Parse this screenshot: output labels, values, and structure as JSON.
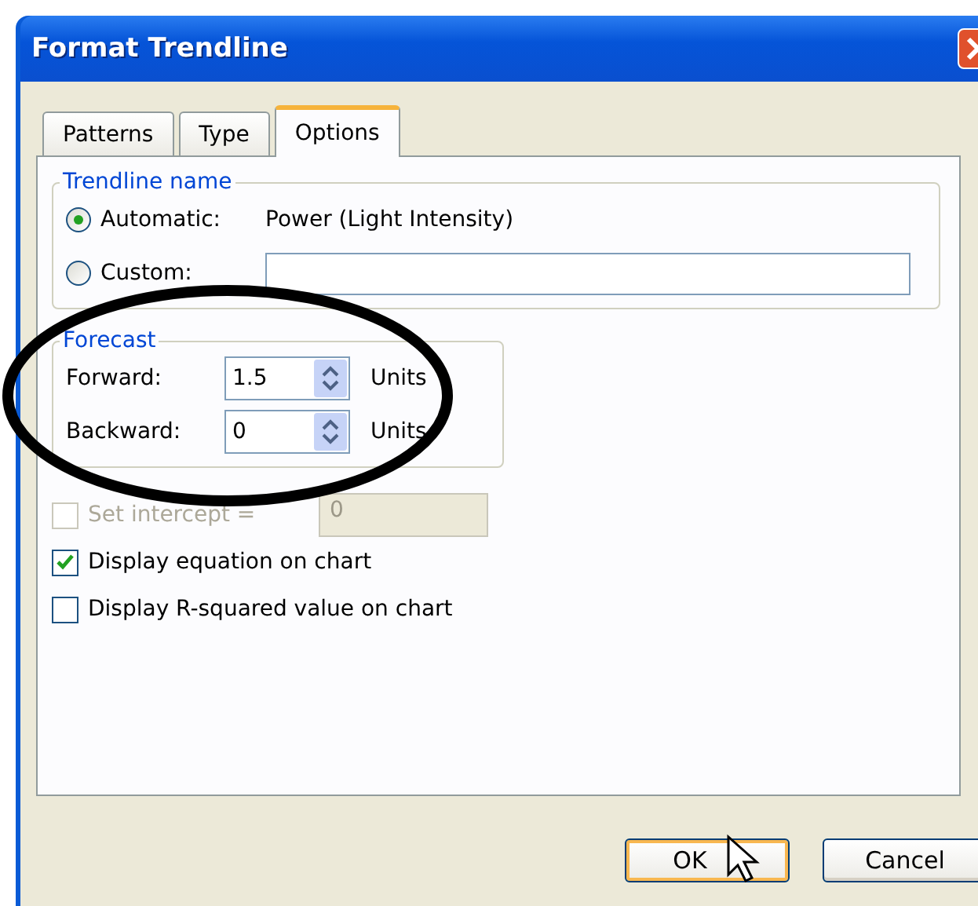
{
  "window": {
    "title": "Format Trendline"
  },
  "tabs": [
    {
      "label": "Patterns",
      "selected": false
    },
    {
      "label": "Type",
      "selected": false
    },
    {
      "label": "Options",
      "selected": true
    }
  ],
  "trendline_name": {
    "legend": "Trendline name",
    "options": [
      {
        "kind": "text",
        "label": "Automatic:",
        "selected": true,
        "value": "Power (Light Intensity)"
      },
      {
        "kind": "field",
        "label": "Custom:",
        "selected": false
      }
    ]
  },
  "forecast": {
    "legend": "Forecast",
    "rows": [
      {
        "label": "Forward:",
        "value": "1.5",
        "unit": "Units"
      },
      {
        "label": "Backward:",
        "value": "0",
        "unit": "Units"
      }
    ]
  },
  "intercept": {
    "label": "Set intercept =",
    "checked": false,
    "disabled": true,
    "value": "0"
  },
  "checkboxes": [
    {
      "label": "Display equation on chart",
      "checked": true,
      "disabled": false
    },
    {
      "label": "Display R-squared value on chart",
      "checked": false,
      "disabled": false
    }
  ],
  "buttons": [
    {
      "label": "OK",
      "default": true
    },
    {
      "label": "Cancel",
      "default": false
    }
  ]
}
